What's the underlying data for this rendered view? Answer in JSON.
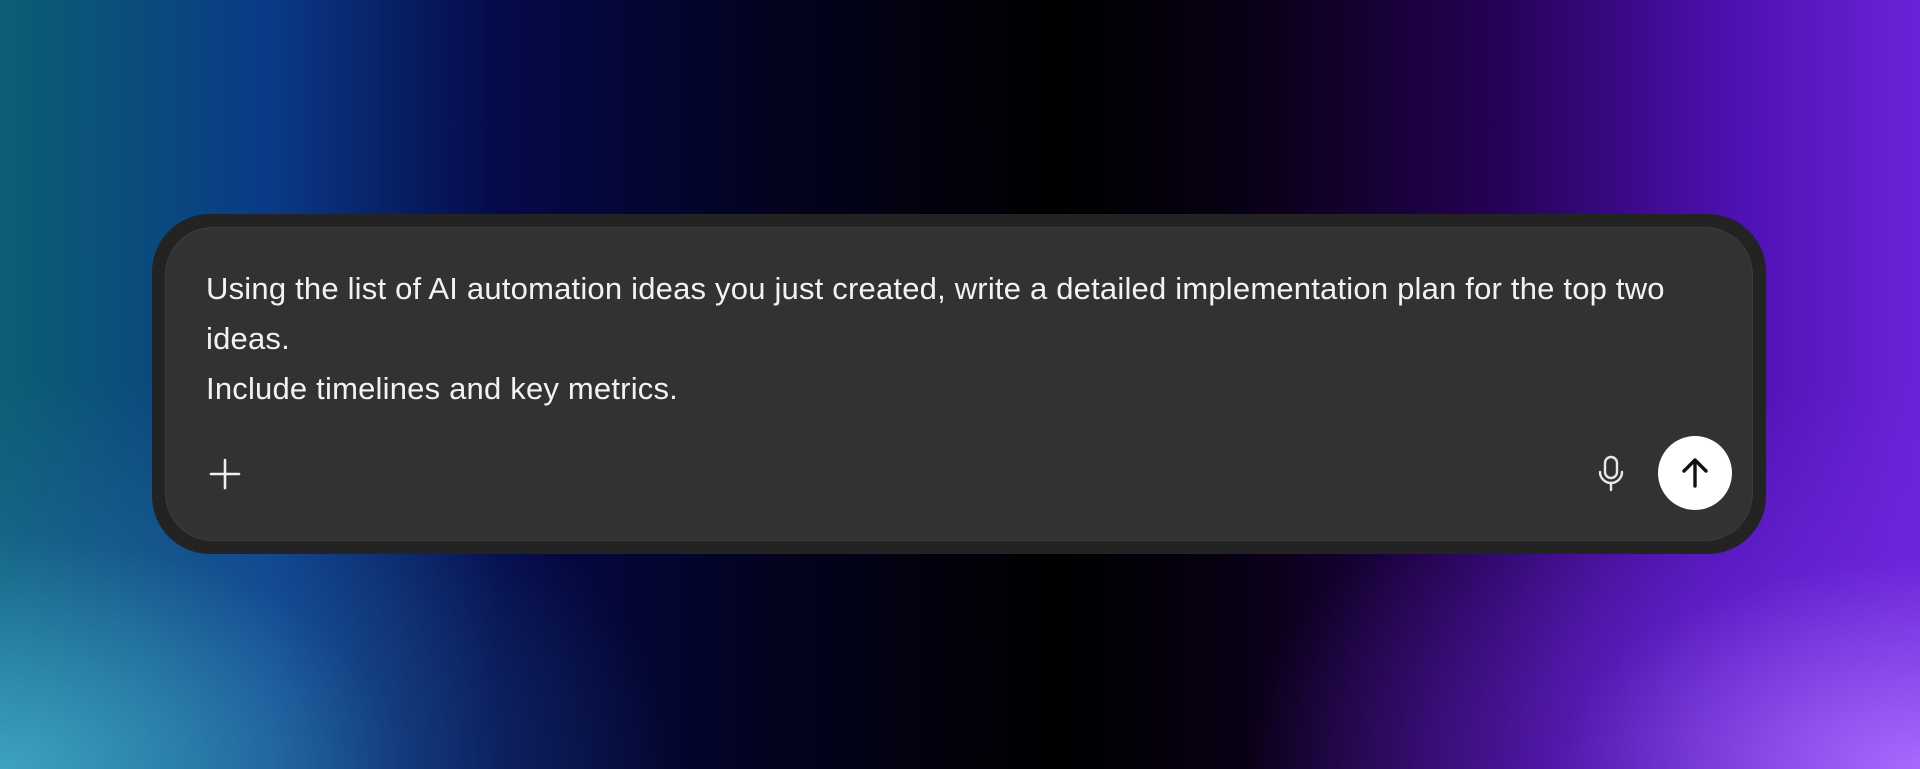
{
  "composer": {
    "text": "Using the list of AI automation ideas you just created, write a detailed implementation plan for the top two ideas.\nInclude timelines and key metrics.",
    "icons": {
      "attach": "plus-icon",
      "voice": "microphone-icon",
      "send": "arrow-up-icon"
    },
    "colors": {
      "panel": "#323232",
      "panel_border": "#232323",
      "text": "#f2f2f2",
      "send_bg": "#ffffff"
    }
  }
}
